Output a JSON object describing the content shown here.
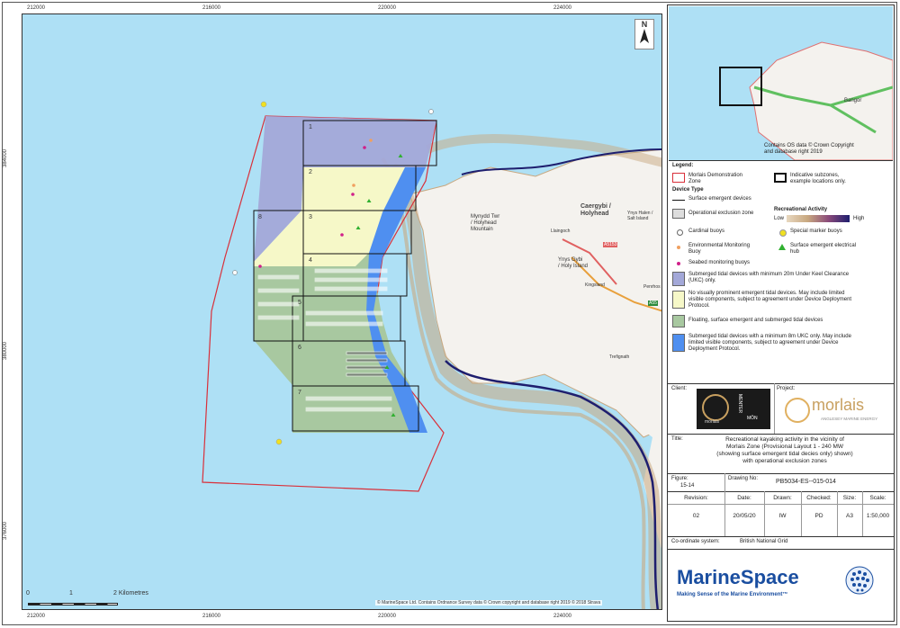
{
  "map": {
    "top_ticks": [
      "212000",
      "216000",
      "220000",
      "224000"
    ],
    "bottom_ticks": [
      "212000",
      "216000",
      "220000",
      "224000"
    ],
    "left_ticks": [
      "384000",
      "380000",
      "376000"
    ],
    "subzones": [
      "1",
      "2",
      "3",
      "4",
      "5",
      "6",
      "7",
      "8"
    ],
    "place_labels": {
      "mynydd": "Mynydd Twr\n/ Holyhead\nMountain",
      "holyhead": "Caergybi /\nHolyhead",
      "holy_island": "Ynys Gybi\n/ Holy Island",
      "llaingoch": "Llaingoch",
      "kingsland": "Kingsland",
      "penrhos": "Penrhos",
      "trefignath": "Trefignath",
      "salt_island": "Ynys Halen /\nSalt Island",
      "a5153": "A5153",
      "a55": "A55"
    },
    "north_arrow": "N",
    "scale_bar": {
      "ticks": [
        "0",
        "1",
        "2 Kilometres"
      ]
    },
    "credit": "© MarineSpace Ltd. Contains Ordnance Survey data © Crown copyright and database right 2019 © 2018 Strava"
  },
  "inset": {
    "label": "Bangor",
    "credit": "Contains OS data © Crown Copyright\nand database right 2019"
  },
  "legend": {
    "title": "Legend:",
    "morlais_zone": "Morlais Demonstration\nZone",
    "indicative_subzones": "Indicative subzones,\nexample locations only.",
    "device_type_header": "Device Type",
    "surface_emergent": "Surface emergent devices",
    "operational_exclusion": "Operational exclusion zone",
    "recreational_activity": "Recreational Activity",
    "low": "Low",
    "high": "High",
    "cardinal_buoys": "Cardinal buoys",
    "special_marker": "Special marker buoys",
    "env_monitoring": "Environmental Monitoring\nBuoy",
    "surface_electrical": "Surface emergent electrical\nhub",
    "seabed_monitoring": "Seabed monitoring buoys",
    "submerged_20m": "Submerged tidal devices with minimum 20m Under Keel Clearance\n(UKC) only.",
    "no_visual": "No visually prominent emergent tidal devices. May include limited\nvisible components, subject to agreement under Device Deployment\nProtocol.",
    "floating": "Floating, surface emergent and submerged tidal devices",
    "submerged_8m": "Submerged tidal devices with a minimum 8m UKC only. May include\nlimited visible components, subject to agreement under Device\nDeployment Protocol."
  },
  "titleblock": {
    "client_label": "Client:",
    "client_logo_text": "morlais",
    "menter_text": "MENTER",
    "mon_text": "MÔN",
    "project_label": "Project:",
    "project_logo": "morlais",
    "project_tagline": "ANGLESEY MARINE ENERGY",
    "title_label": "Title:",
    "title": "Recreational kayaking activity in the vicinity of\nMorlais Zone (Provisional Layout 1 - 240 MW\n(showing surface emergent tidal decies only) shown)\nwith operational exclusion zones",
    "figure_label": "Figure:",
    "figure": "15-14",
    "drawing_no_label": "Drawing No:",
    "drawing_no": "PB5034-ES--015-014",
    "revision_label": "Revision:",
    "revision": "02",
    "date_label": "Date:",
    "date": "20/05/20",
    "drawn_label": "Drawn:",
    "drawn": "IW",
    "checked_label": "Checked:",
    "checked": "PD",
    "size_label": "Size:",
    "size": "A3",
    "scale_label": "Scale:",
    "scale": "1:50,000",
    "coord_label": "Co-ordinate system:",
    "coord": "British National Grid",
    "company": "MarineSpace",
    "company_tagline": "Making Sense of the Marine Environment™"
  },
  "colors": {
    "sea": "#aee0f5",
    "land": "#f4f2ee",
    "zone_outline": "#d9303a",
    "submerged_20m": "#a3a8d8",
    "no_visual": "#f6f8c8",
    "floating": "#a8c8a0",
    "submerged_8m": "#4f8ff0",
    "track": "#c8a880",
    "track_high": "#1e1e6e"
  }
}
